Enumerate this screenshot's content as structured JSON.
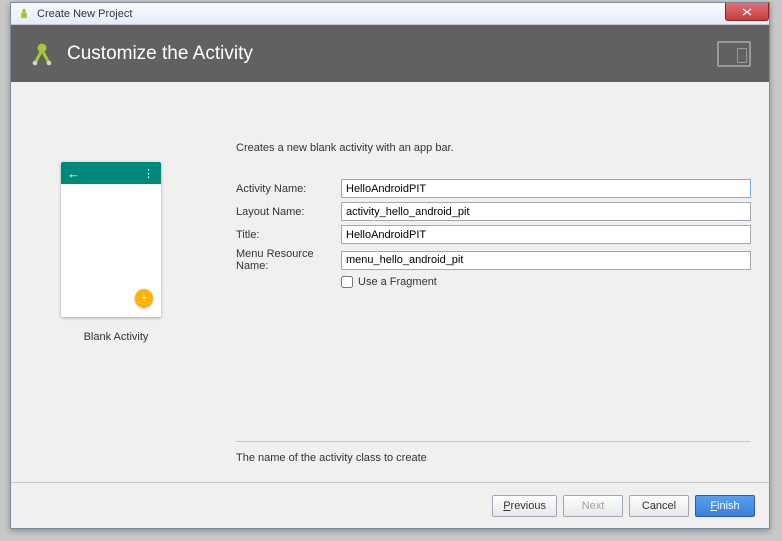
{
  "window": {
    "title": "Create New Project"
  },
  "banner": {
    "title": "Customize the Activity"
  },
  "preview": {
    "caption": "Blank Activity"
  },
  "form": {
    "description": "Creates a new blank activity with an app bar.",
    "activity_name_label": "Activity Name:",
    "activity_name_value": "HelloAndroidPIT",
    "layout_name_label": "Layout Name:",
    "layout_name_value": "activity_hello_android_pit",
    "title_label": "Title:",
    "title_value": "HelloAndroidPIT",
    "menu_resource_label": "Menu Resource Name:",
    "menu_resource_value": "menu_hello_android_pit",
    "use_fragment_label": "Use a Fragment"
  },
  "hint": {
    "text": "The name of the activity class to create"
  },
  "footer": {
    "previous": "Previous",
    "next": "Next",
    "cancel": "Cancel",
    "finish": "Finish"
  }
}
